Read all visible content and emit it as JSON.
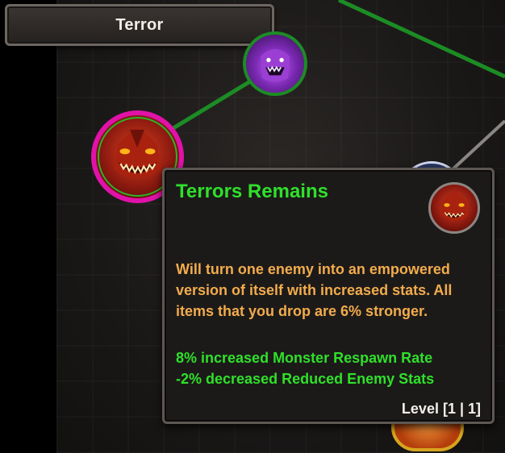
{
  "header": {
    "title": "Terror"
  },
  "tooltip": {
    "title": "Terrors Remains",
    "description": "Will turn one enemy into an empowered version of itself with increased stats. All items that you drop are 6% stronger.",
    "stats": [
      "8% increased Monster Respawn Rate",
      "-2% decreased Reduced Enemy Stats"
    ],
    "level_label": "Level [1 | 1]"
  },
  "colors": {
    "title_green": "#2fe02a",
    "description_orange": "#f2ac4c",
    "selected_node_ring": "#e012a8",
    "link_green": "#1c8c25"
  },
  "icons": {
    "selected_node": "terror-demon-icon",
    "purple_node": "purple-ghoul-icon",
    "tooltip_icon": "terror-demon-icon"
  }
}
